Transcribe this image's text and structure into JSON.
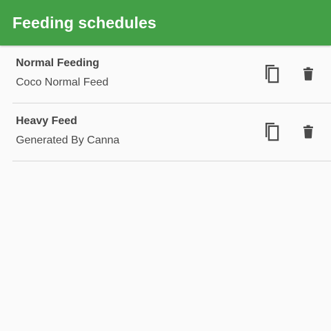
{
  "app_bar": {
    "title": "Feeding schedules",
    "color": "#43a047"
  },
  "schedules": [
    {
      "title": "Normal Feeding",
      "subtitle": "Coco Normal Feed",
      "actions": [
        "copy-icon",
        "delete-icon"
      ]
    },
    {
      "title": "Heavy Feed",
      "subtitle": "Generated By Canna",
      "actions": [
        "copy-icon",
        "delete-icon"
      ]
    }
  ]
}
